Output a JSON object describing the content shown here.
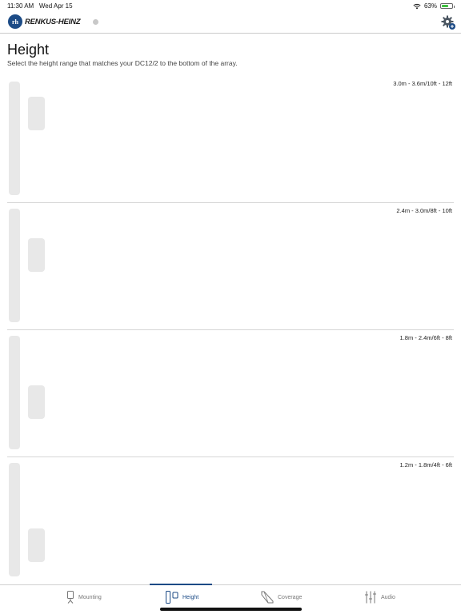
{
  "status_bar": {
    "time": "11:30 AM",
    "date": "Wed Apr 15",
    "battery": "63%",
    "battery_level": 0.63
  },
  "header": {
    "logo_text": "RENKUS-HEINZ",
    "logo_mark": "rh",
    "settings_icon": "gear-plus-icon"
  },
  "page": {
    "title": "Height",
    "subtitle": "Select the height range that matches your DC12/2 to the bottom of the array."
  },
  "ranges": [
    {
      "label": "3.0m - 3.6m/10ft - 12ft"
    },
    {
      "label": "2.4m - 3.0m/8ft - 10ft"
    },
    {
      "label": "1.8m - 2.4m/6ft - 8ft"
    },
    {
      "label": "1.2m - 1.8m/4ft - 6ft"
    }
  ],
  "tabs": [
    {
      "label": "Mounting",
      "icon": "mounting-icon",
      "active": false
    },
    {
      "label": "Height",
      "icon": "height-icon",
      "active": true
    },
    {
      "label": "Coverage",
      "icon": "coverage-icon",
      "active": false
    },
    {
      "label": "Audio",
      "icon": "sliders-icon",
      "active": false
    }
  ],
  "colors": {
    "accent": "#1c4b86",
    "placeholder": "#e8e8e8",
    "battery": "#3fbf3f"
  }
}
